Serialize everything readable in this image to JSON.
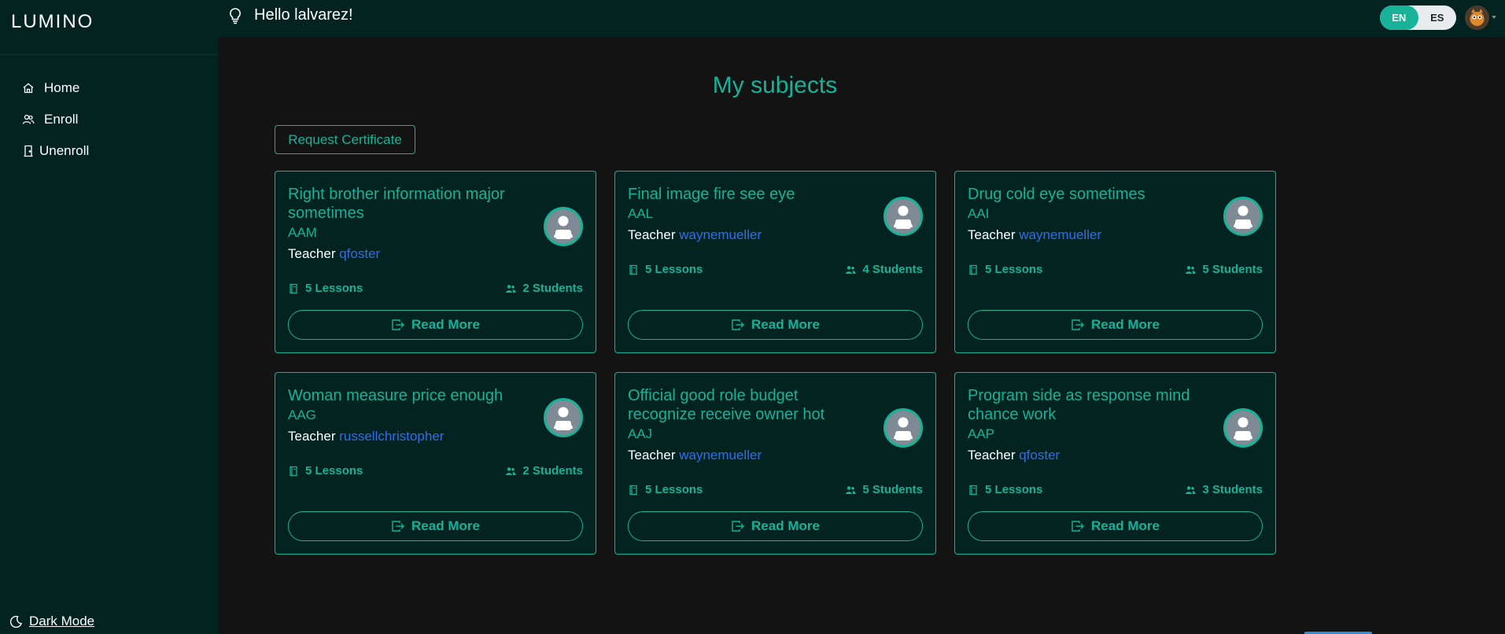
{
  "app": {
    "logo": "LUMINO"
  },
  "header": {
    "greeting": "Hello lalvarez!"
  },
  "language": {
    "options": [
      "EN",
      "ES"
    ],
    "selected": "EN"
  },
  "sidebar": {
    "items": [
      {
        "label": "Home",
        "icon": "home-icon"
      },
      {
        "label": "Enroll",
        "icon": "users-icon"
      },
      {
        "label": "Unenroll",
        "icon": "door-icon"
      }
    ],
    "dark_mode_label": "Dark Mode"
  },
  "main": {
    "title": "My subjects",
    "request_certificate_label": "Request Certificate",
    "teacher_label": "Teacher",
    "read_more_label": "Read More",
    "subjects": [
      {
        "title": "Right brother information major sometimes",
        "code": "AAM",
        "teacher": "qfoster",
        "lessons": "5 Lessons",
        "students": "2 Students"
      },
      {
        "title": "Final image fire see eye",
        "code": "AAL",
        "teacher": "waynemueller",
        "lessons": "5 Lessons",
        "students": "4 Students"
      },
      {
        "title": "Drug cold eye sometimes",
        "code": "AAI",
        "teacher": "waynemueller",
        "lessons": "5 Lessons",
        "students": "5 Students"
      },
      {
        "title": "Woman measure price enough",
        "code": "AAG",
        "teacher": "russellchristopher",
        "lessons": "5 Lessons",
        "students": "2 Students"
      },
      {
        "title": "Official good role budget recognize receive owner hot",
        "code": "AAJ",
        "teacher": "waynemueller",
        "lessons": "5 Lessons",
        "students": "5 Students"
      },
      {
        "title": "Program side as response mind chance work",
        "code": "AAP",
        "teacher": "qfoster",
        "lessons": "5 Lessons",
        "students": "3 Students"
      }
    ]
  },
  "colors": {
    "accent": "#17b297",
    "sidebar_bg": "#032321",
    "page_bg": "#131313",
    "link": "#2f6ee8"
  }
}
